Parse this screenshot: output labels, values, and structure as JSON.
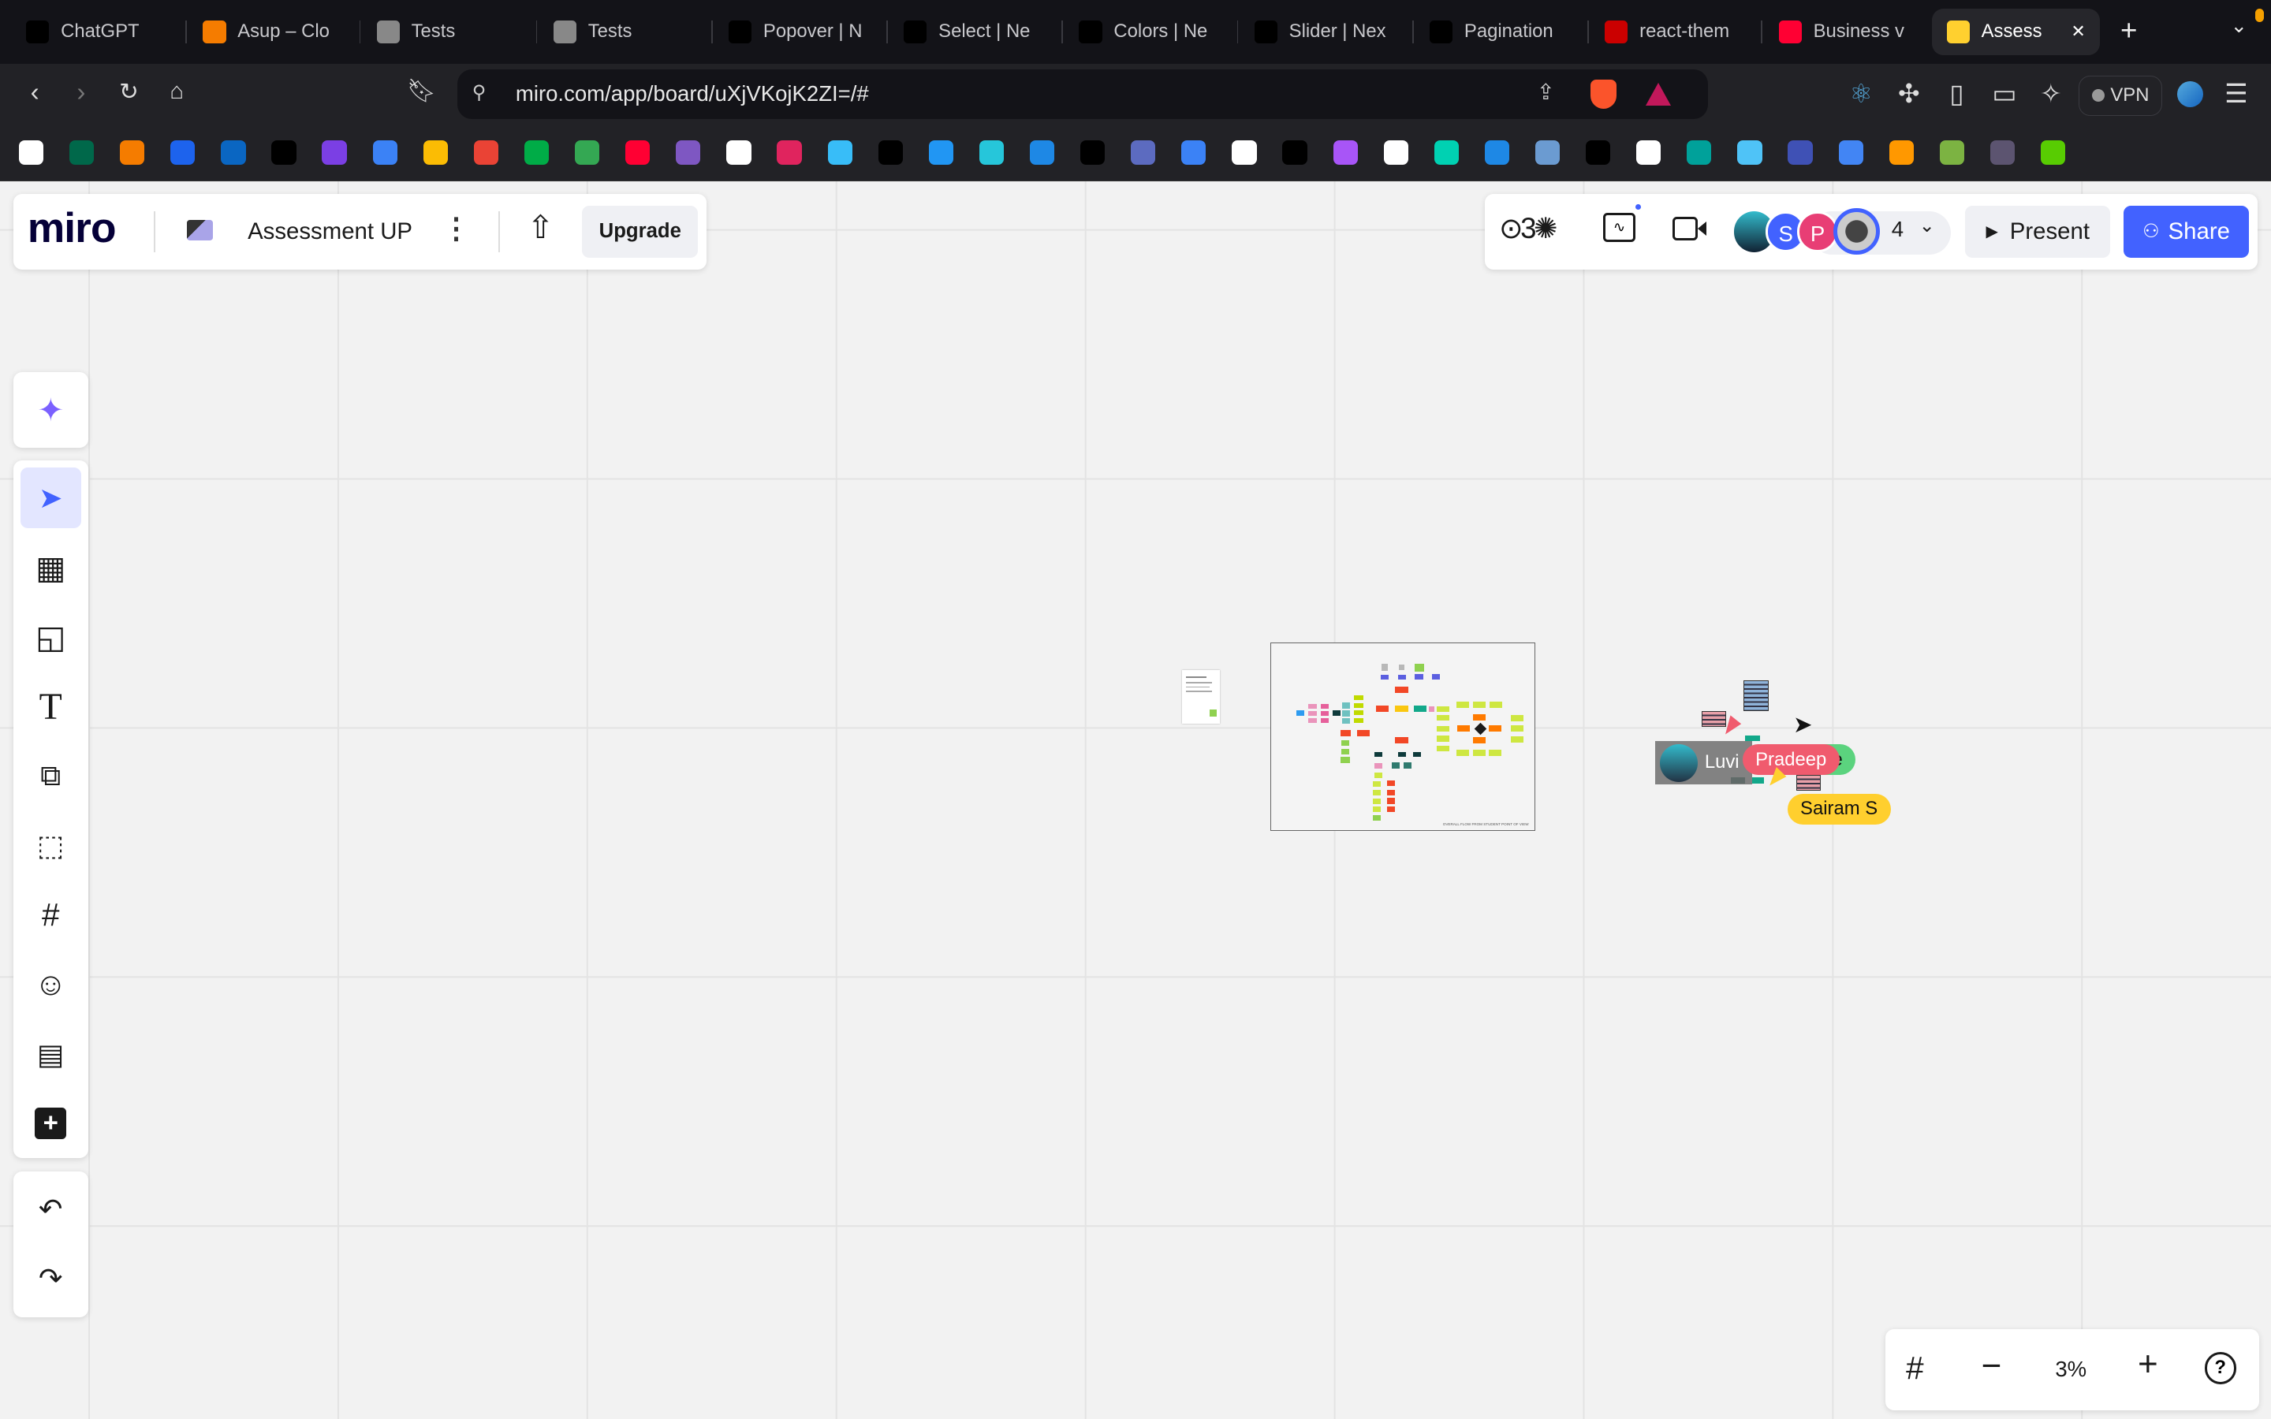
{
  "browser": {
    "tabs": [
      {
        "label": "ChatGPT",
        "icon": "chatgpt-icon",
        "color": "#000"
      },
      {
        "label": "Asup – Clo",
        "icon": "firebase-icon",
        "color": "#f57c00"
      },
      {
        "label": "Tests",
        "icon": "globe-icon",
        "color": "#888"
      },
      {
        "label": "Tests",
        "icon": "globe-icon",
        "color": "#888"
      },
      {
        "label": "Popover | N",
        "icon": "nextui-icon",
        "color": "#000"
      },
      {
        "label": "Select | Ne",
        "icon": "nextui-icon",
        "color": "#000"
      },
      {
        "label": "Colors | Ne",
        "icon": "nextui-icon",
        "color": "#000"
      },
      {
        "label": "Slider | Nex",
        "icon": "nextui-icon",
        "color": "#000"
      },
      {
        "label": "Pagination",
        "icon": "nextui-icon",
        "color": "#000"
      },
      {
        "label": "react-them",
        "icon": "npm-icon",
        "color": "#cb0000"
      },
      {
        "label": "Business v",
        "icon": "youtube-icon",
        "color": "#ff0033"
      },
      {
        "label": "Assess",
        "icon": "miro-icon",
        "color": "#ffd02f"
      }
    ],
    "url": "miro.com/app/board/uXjVKojK2ZI=/#",
    "vpn_label": "VPN",
    "bookmark_colors": [
      "#fff",
      "#00684a",
      "#f57c00",
      "#1d63ed",
      "#0a66c2",
      "#000",
      "#7b3fe4",
      "#3b82f6",
      "#fbbc04",
      "#ea4335",
      "#00ac47",
      "#34a853",
      "#ff0033",
      "#7e57c2",
      "#fff",
      "#e0245e",
      "#38bdf8",
      "#000",
      "#2196f3",
      "#26c6da",
      "#1e88e5",
      "#000",
      "#5c6bc0",
      "#3b82f6",
      "#fff",
      "#000",
      "#a855f7",
      "#fff",
      "#00d1b2",
      "#1e88e5",
      "#6b9bd1",
      "#000",
      "#fff",
      "#00a19a",
      "#4fc3f7",
      "#3f51b5",
      "#4285f4",
      "#ff9800",
      "#7cb342",
      "#5c5470",
      "#58cc02"
    ]
  },
  "board": {
    "logo": "miro",
    "name": "Assessment UP",
    "upgrade": "Upgrade",
    "collaborator_count": "4",
    "avatars": [
      {
        "initial": "S",
        "color": "#4262ff"
      },
      {
        "initial": "P",
        "color": "#e83e75"
      }
    ],
    "present": "Present",
    "share": "Share",
    "zoom_level": "3%",
    "frame_caption": "OVERALL FLOW FROM STUDENT POINT OF VIEW",
    "cursors": [
      {
        "name": "Luvi",
        "color": "#7a7a7a"
      },
      {
        "name": "e",
        "color": "#5bd37e"
      },
      {
        "name": "Pradeep",
        "color": "#f05b6e"
      },
      {
        "name": "Sairam S",
        "color": "#ffcf2e"
      }
    ]
  }
}
